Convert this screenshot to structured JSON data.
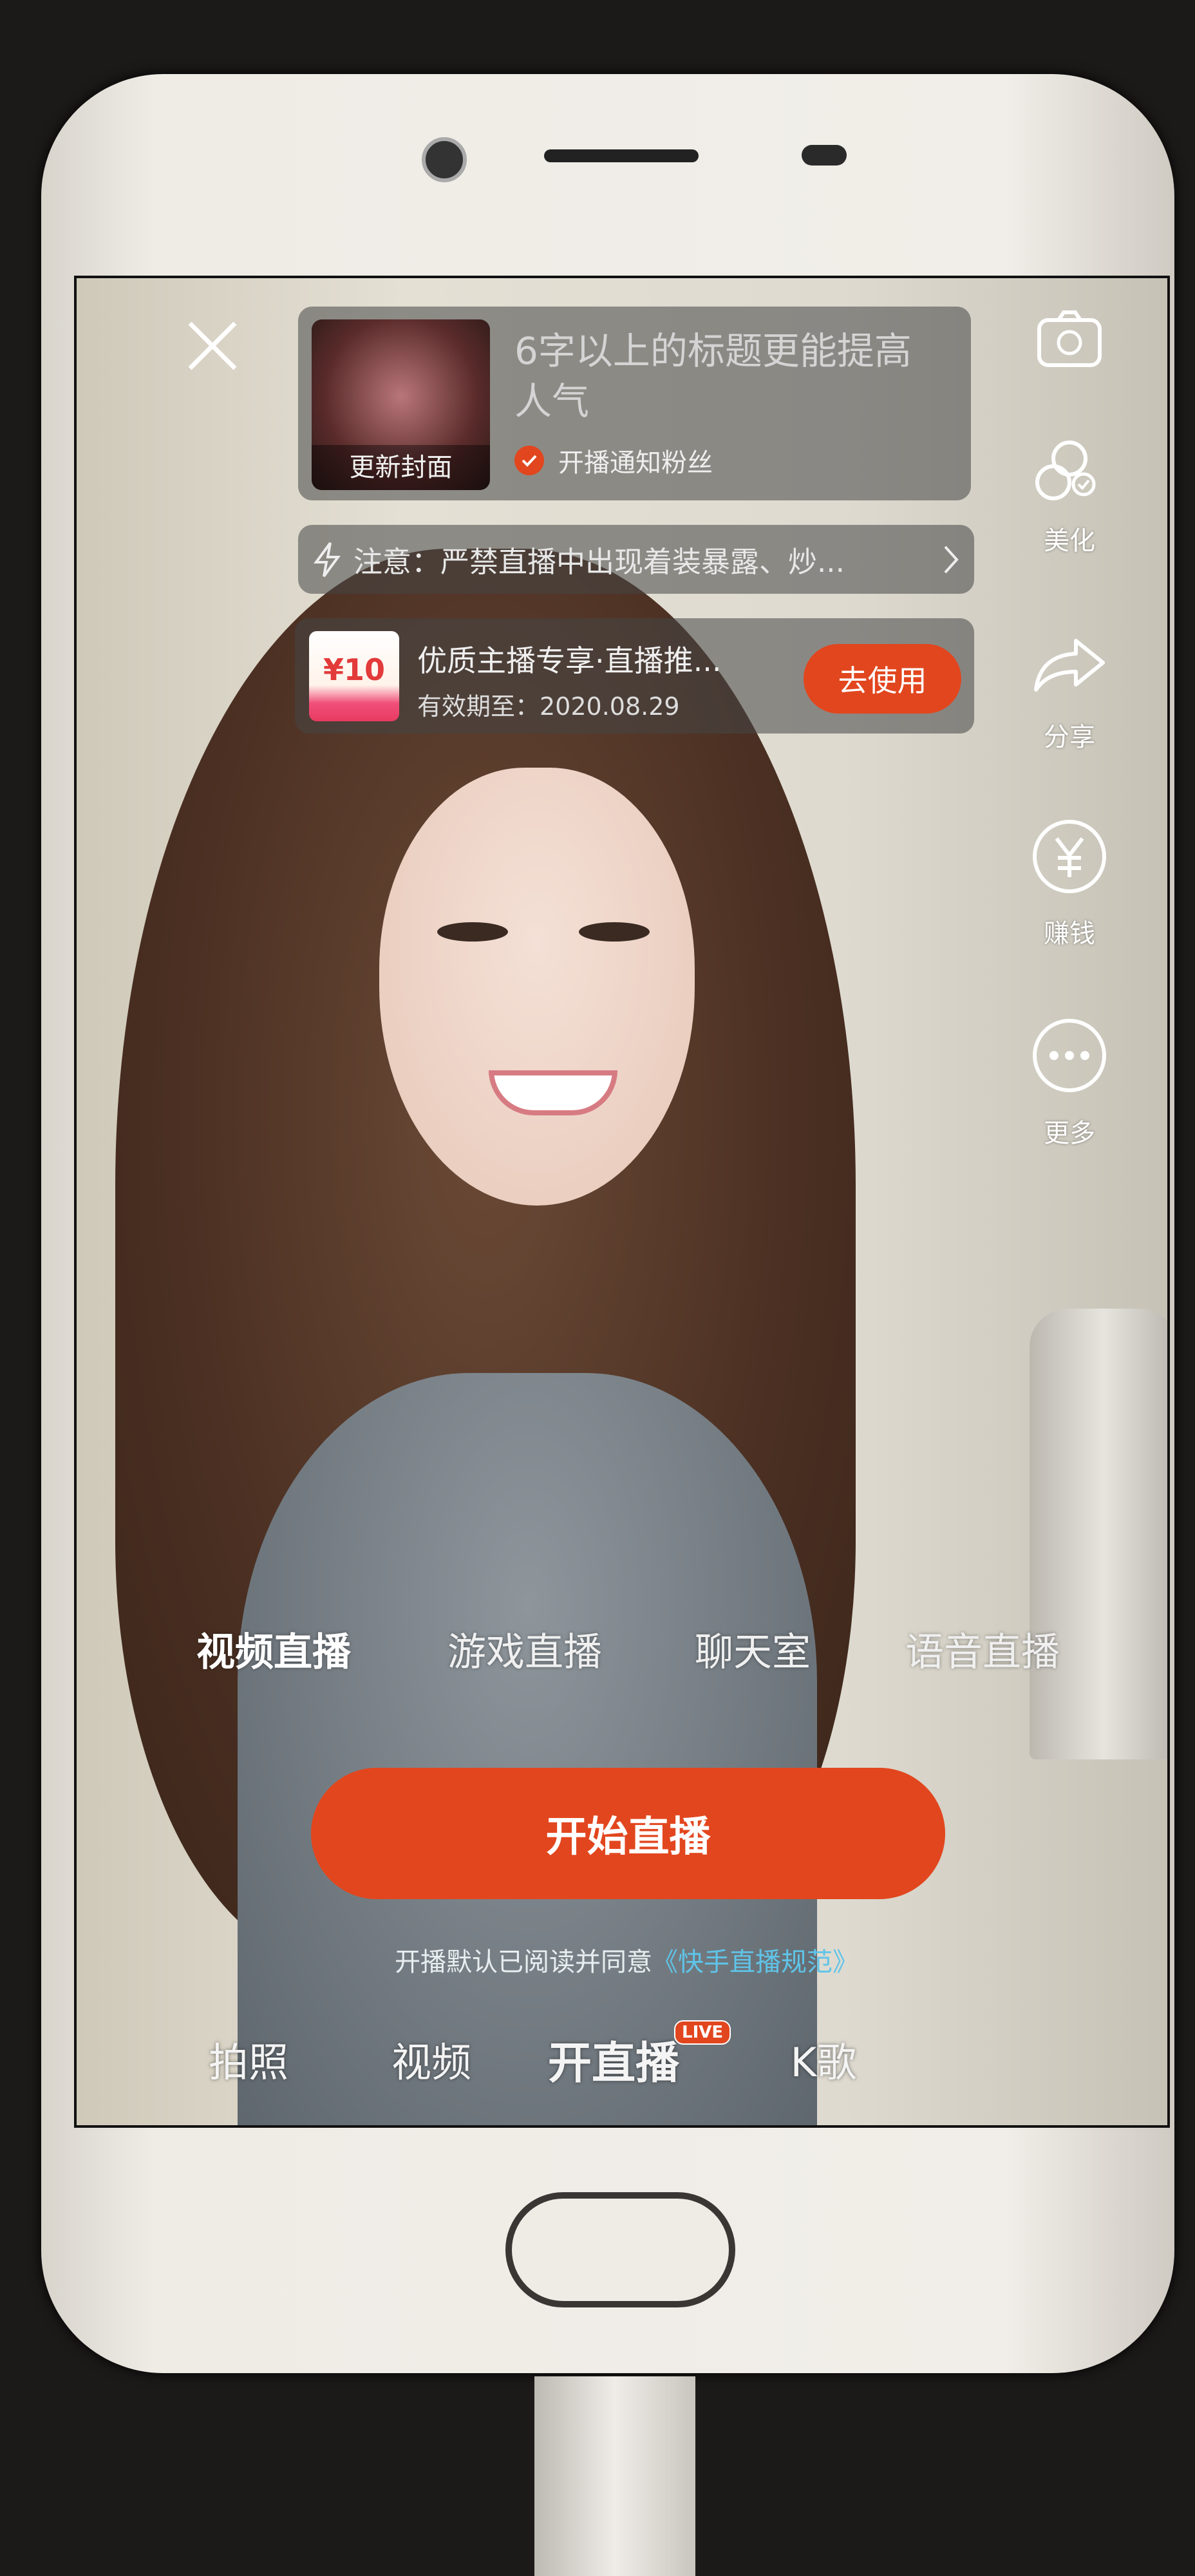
{
  "header": {
    "title_placeholder": "6字以上的标题更能提高人气",
    "cover_label": "更新封面",
    "notify_fans_label": "开播通知粉丝",
    "notify_fans_checked": true
  },
  "notice": {
    "text": "注意：严禁直播中出现着装暴露、炒..."
  },
  "coupon": {
    "amount": "¥10",
    "title": "优质主播专享·直播推...",
    "expiry": "有效期至：2020.08.29",
    "use_button": "去使用"
  },
  "side_menu": [
    {
      "icon": "camera-flip-icon",
      "label": ""
    },
    {
      "icon": "beautify-icon",
      "label": "美化"
    },
    {
      "icon": "share-icon",
      "label": "分享"
    },
    {
      "icon": "yuan-coin-icon",
      "label": "赚钱"
    },
    {
      "icon": "more-icon",
      "label": "更多"
    }
  ],
  "live_modes": [
    {
      "label": "视频直播",
      "active": true
    },
    {
      "label": "游戏直播",
      "active": false
    },
    {
      "label": "聊天室",
      "active": false
    },
    {
      "label": "语音直播",
      "active": false
    }
  ],
  "start_button": "开始直播",
  "agreement": {
    "prefix": "开播默认已阅读并同意",
    "link": "《快手直播规范》"
  },
  "bottom_tabs": [
    {
      "label": "拍照"
    },
    {
      "label": "视频"
    },
    {
      "label": "开直播",
      "active": true,
      "badge": "LIVE"
    },
    {
      "label": "K歌"
    }
  ],
  "colors": {
    "accent": "#e2461e",
    "link": "#5fc4e8"
  }
}
